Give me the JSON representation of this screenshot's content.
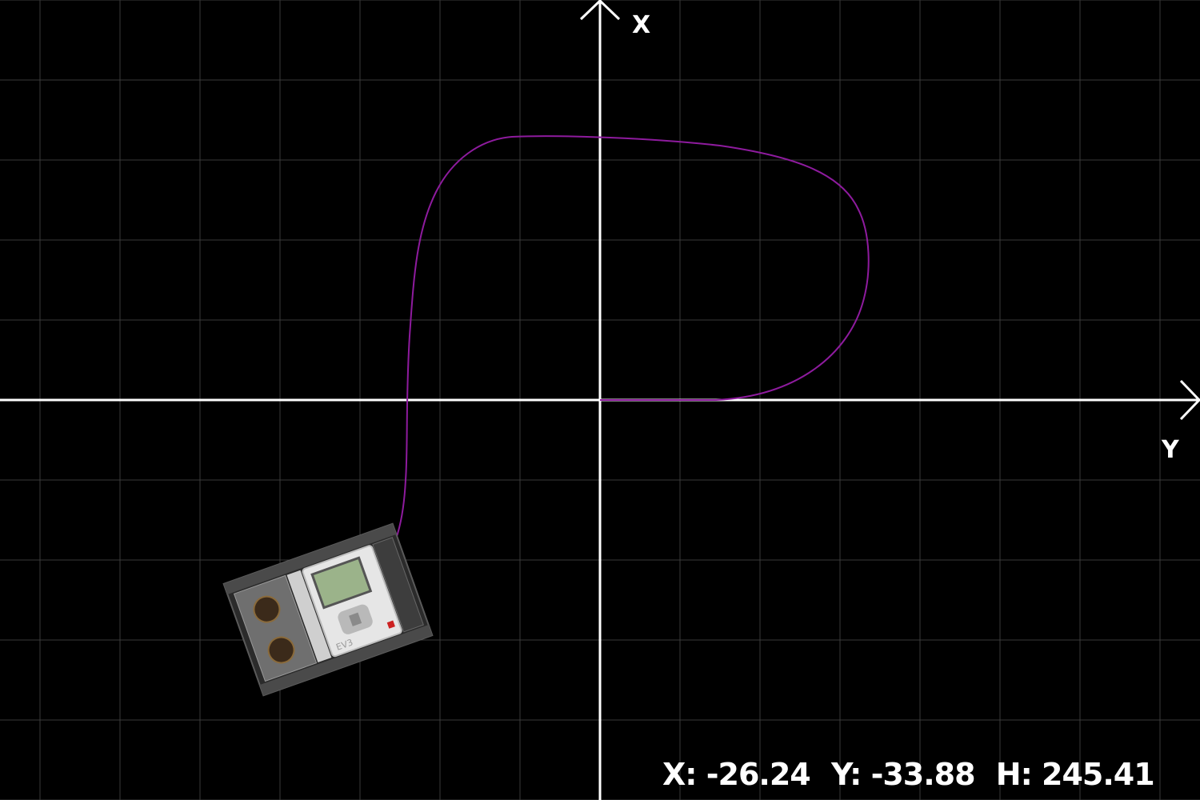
{
  "axes": {
    "x_label": "X",
    "y_label": "Y"
  },
  "status": {
    "x_label": "X:",
    "x_value": "-26.24",
    "y_label": "Y:",
    "y_value": "-33.88",
    "heading_label": "H:",
    "heading_value": "245.41"
  },
  "robot": {
    "name": "EV3",
    "heading_deg": 245.41
  },
  "colors": {
    "background": "#000000",
    "grid": "#3a3a3a",
    "axis": "#ffffff",
    "path": "#8e1b9e"
  }
}
